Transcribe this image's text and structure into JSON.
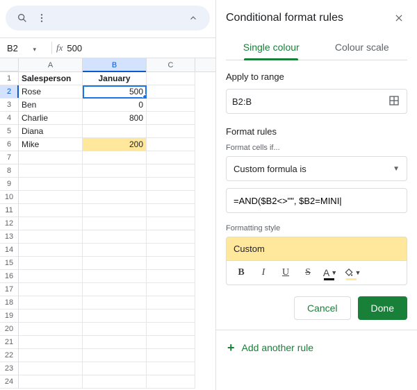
{
  "toolbar": {
    "namebox_ref": "B2",
    "namebox_dropdown": "▾",
    "formula_value": "500"
  },
  "sheet": {
    "columns": [
      "A",
      "B",
      "C"
    ],
    "selected_col_index": 1,
    "selected_row": 2,
    "selected_cell": "B2",
    "highlight_cell": "B6",
    "header_row": [
      "Salesperson",
      "January",
      ""
    ],
    "rows": [
      {
        "n": 1,
        "a": "Salesperson",
        "b": "January",
        "c": ""
      },
      {
        "n": 2,
        "a": "Rose",
        "b": "500",
        "c": ""
      },
      {
        "n": 3,
        "a": "Ben",
        "b": "0",
        "c": ""
      },
      {
        "n": 4,
        "a": "Charlie",
        "b": "800",
        "c": ""
      },
      {
        "n": 5,
        "a": "Diana",
        "b": "",
        "c": ""
      },
      {
        "n": 6,
        "a": "Mike",
        "b": "200",
        "c": ""
      },
      {
        "n": 7,
        "a": "",
        "b": "",
        "c": ""
      },
      {
        "n": 8,
        "a": "",
        "b": "",
        "c": ""
      },
      {
        "n": 9,
        "a": "",
        "b": "",
        "c": ""
      },
      {
        "n": 10,
        "a": "",
        "b": "",
        "c": ""
      },
      {
        "n": 11,
        "a": "",
        "b": "",
        "c": ""
      },
      {
        "n": 12,
        "a": "",
        "b": "",
        "c": ""
      },
      {
        "n": 13,
        "a": "",
        "b": "",
        "c": ""
      },
      {
        "n": 14,
        "a": "",
        "b": "",
        "c": ""
      },
      {
        "n": 15,
        "a": "",
        "b": "",
        "c": ""
      },
      {
        "n": 16,
        "a": "",
        "b": "",
        "c": ""
      },
      {
        "n": 17,
        "a": "",
        "b": "",
        "c": ""
      },
      {
        "n": 18,
        "a": "",
        "b": "",
        "c": ""
      },
      {
        "n": 19,
        "a": "",
        "b": "",
        "c": ""
      },
      {
        "n": 20,
        "a": "",
        "b": "",
        "c": ""
      },
      {
        "n": 21,
        "a": "",
        "b": "",
        "c": ""
      },
      {
        "n": 22,
        "a": "",
        "b": "",
        "c": ""
      },
      {
        "n": 23,
        "a": "",
        "b": "",
        "c": ""
      },
      {
        "n": 24,
        "a": "",
        "b": "",
        "c": ""
      }
    ]
  },
  "panel": {
    "title": "Conditional format rules",
    "tab_single": "Single colour",
    "tab_scale": "Colour scale",
    "apply_label": "Apply to range",
    "range_value": "B2:B",
    "format_rules_label": "Format rules",
    "format_cells_if_label": "Format cells if...",
    "condition_selected": "Custom formula is",
    "formula_value": "=AND($B2<>\"\", $B2=MINI|",
    "formatting_style_label": "Formatting style",
    "style_preview_text": "Custom",
    "cancel": "Cancel",
    "done": "Done",
    "add_rule": "Add another rule",
    "tb": {
      "bold": "B",
      "italic": "I",
      "underline": "U",
      "strike": "S",
      "textcolor": "A"
    }
  }
}
